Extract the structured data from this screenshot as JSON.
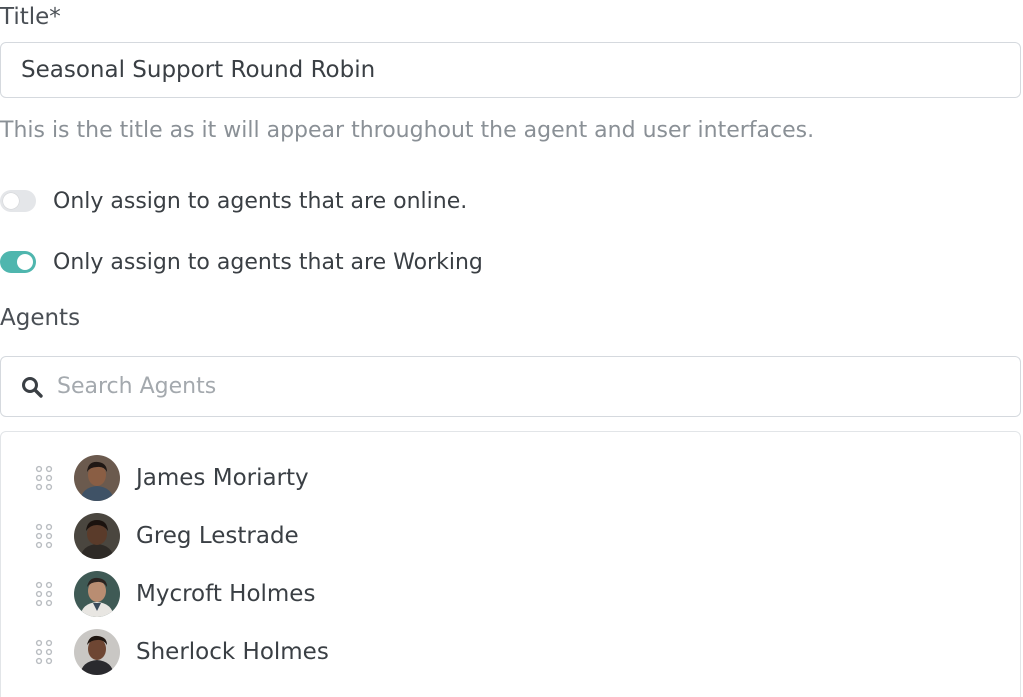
{
  "title_field": {
    "label": "Title*",
    "value": "Seasonal Support Round Robin",
    "help_text": "This is the title as it will appear throughout the agent and user interfaces."
  },
  "toggles": [
    {
      "label": "Only assign to agents that are online.",
      "state": "off"
    },
    {
      "label": "Only assign to agents that are Working",
      "state": "on"
    }
  ],
  "agents_section": {
    "label": "Agents",
    "search_placeholder": "Search Agents",
    "search_icon": "search-icon",
    "drag_icon": "drag-handle-icon",
    "agents": [
      {
        "name": "James Moriarty",
        "avatar_bg": "#6b5a4e",
        "skin": "#8a5e44",
        "hair": "#1f1714",
        "shirt": "#3f5266"
      },
      {
        "name": "Greg Lestrade",
        "avatar_bg": "#4a463f",
        "skin": "#5a3b2a",
        "hair": "#1a120e",
        "shirt": "#2e2a26"
      },
      {
        "name": "Mycroft Holmes",
        "avatar_bg": "#3f5a55",
        "skin": "#b98d72",
        "hair": "#2b2320",
        "shirt": "#e8e6e2"
      },
      {
        "name": "Sherlock Holmes",
        "avatar_bg": "#c9c7c4",
        "skin": "#6e4633",
        "hair": "#1e1510",
        "shirt": "#2a2a2e"
      }
    ]
  },
  "colors": {
    "toggle_on": "#4fb6ae",
    "toggle_off": "#e4e6e9",
    "border": "#d5d9de",
    "muted_text": "#8a9096"
  }
}
